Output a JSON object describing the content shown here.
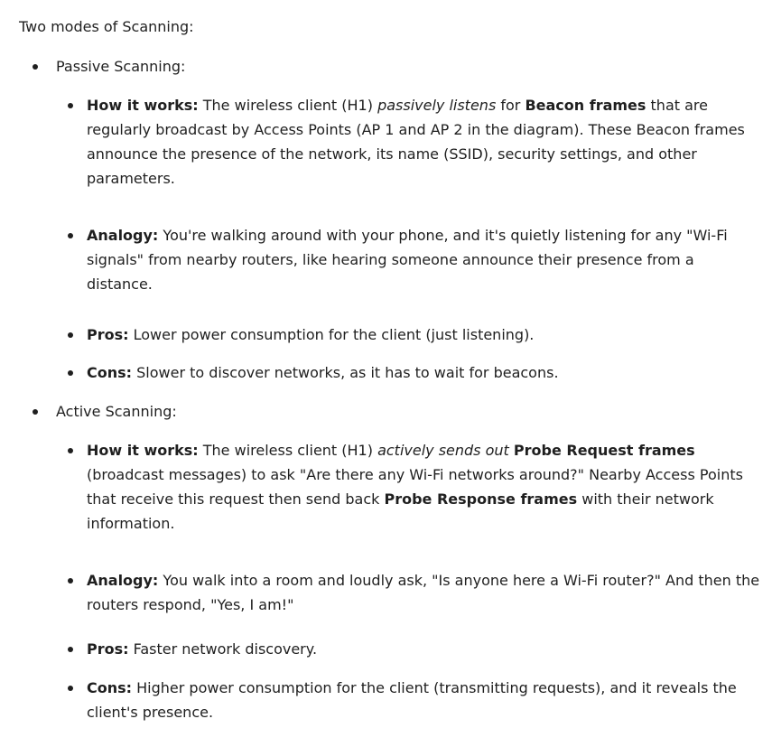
{
  "heading": "Two modes of Scanning:",
  "passive": {
    "title": "Passive Scanning:",
    "items": [
      {
        "label": "How it works:",
        "t1": " The wireless client (H1) ",
        "em": "passively listens",
        "t2": " for ",
        "b2": "Beacon frames",
        "t3": " that are regularly broadcast by Access Points (AP 1 and AP 2 in the diagram). These Beacon frames announce the presence of the network, its name (SSID), security settings, and other parameters."
      },
      {
        "label": "Analogy:",
        "text": " You're walking around with your phone, and it's quietly listening for any \"Wi-Fi signals\" from nearby routers, like hearing someone announce their presence from a distance."
      },
      {
        "label": "Pros:",
        "text": " Lower power consumption for the client (just listening)."
      },
      {
        "label": "Cons:",
        "text": " Slower to discover networks, as it has to wait for beacons."
      }
    ]
  },
  "active": {
    "title": "Active Scanning:",
    "items": [
      {
        "label": "How it works:",
        "t1": " The wireless client (H1) ",
        "em": "actively sends out",
        "t2": " ",
        "b2": "Probe Request frames",
        "t3": " (broadcast messages) to ask \"Are there any Wi-Fi networks around?\" Nearby Access Points that receive this request then send back ",
        "b3": "Probe Response frames",
        "t4": " with their network information."
      },
      {
        "label": "Analogy:",
        "text": " You walk into a room and loudly ask, \"Is anyone here a Wi-Fi router?\" And then the routers respond, \"Yes, I am!\""
      },
      {
        "label": "Pros:",
        "text": " Faster network discovery."
      },
      {
        "label": "Cons:",
        "text": " Higher power consumption for the client (transmitting requests), and it reveals the client's presence."
      }
    ]
  }
}
